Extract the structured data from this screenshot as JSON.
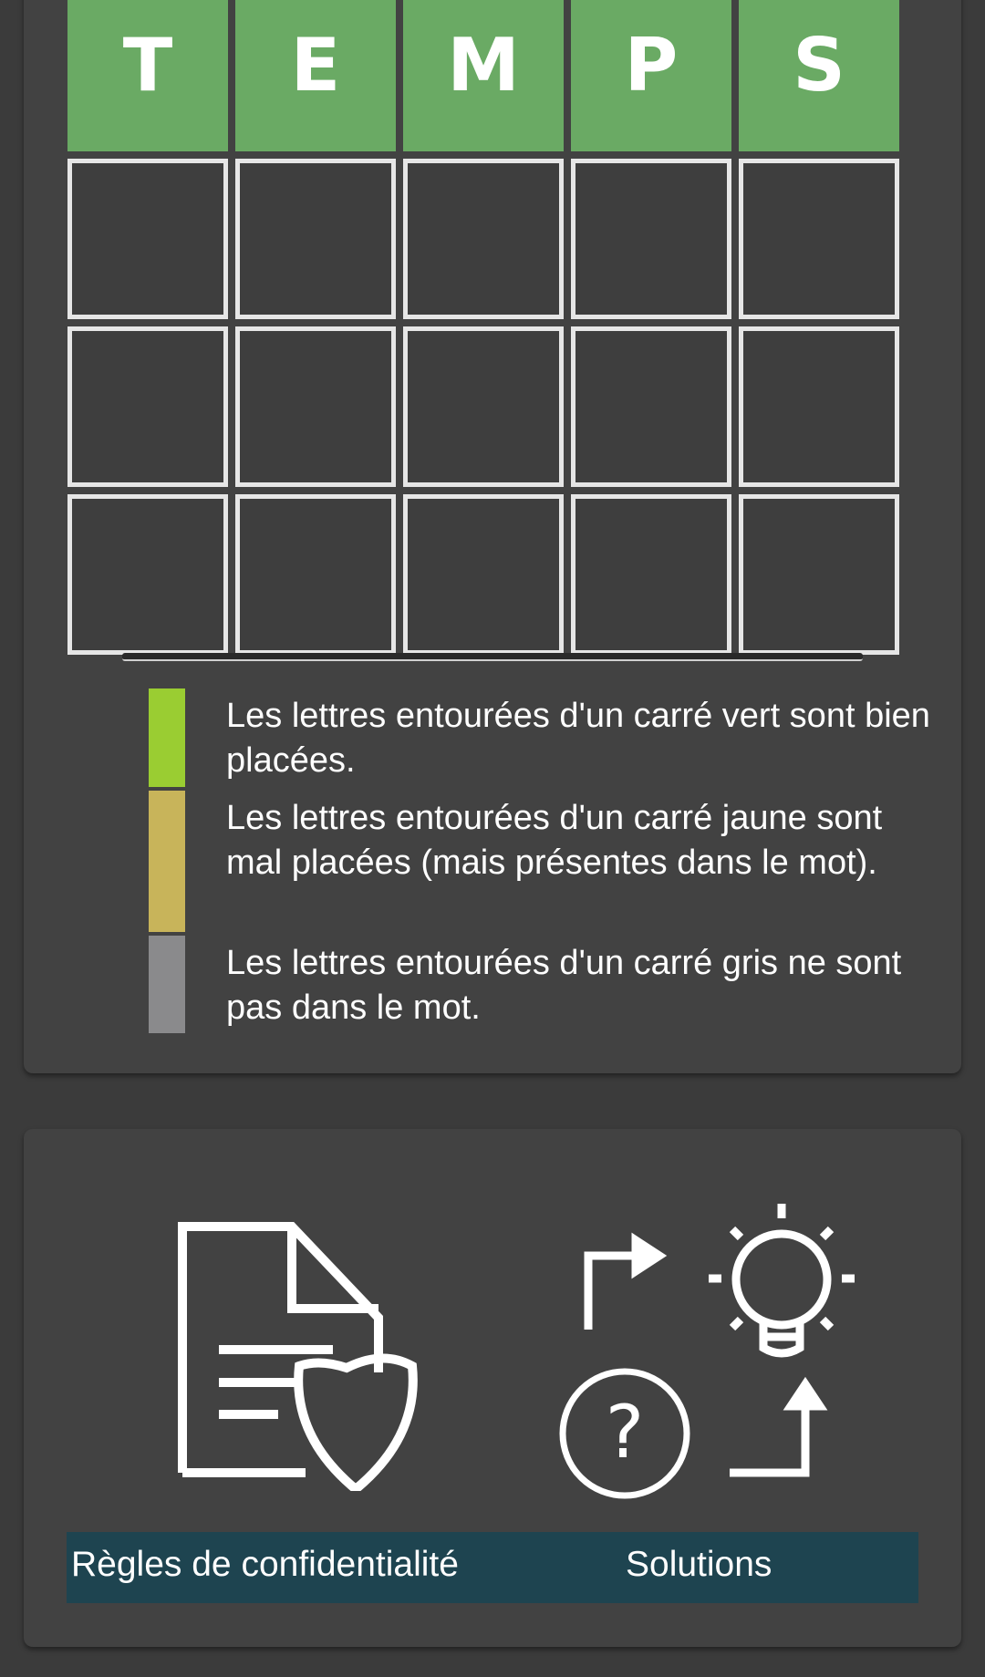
{
  "grid": {
    "rows": [
      [
        "T",
        "E",
        "M",
        "P",
        "S"
      ],
      [
        "",
        "",
        "",
        "",
        ""
      ],
      [
        "",
        "",
        "",
        "",
        ""
      ],
      [
        "",
        "",
        "",
        "",
        ""
      ]
    ]
  },
  "legend": {
    "items": [
      {
        "color": "#9acd32",
        "text": "Les lettres entourées d'un carré vert sont bien placées."
      },
      {
        "color": "#c8b45a",
        "text": "Les lettres entourées d'un carré jaune sont mal placées (mais présentes dans le mot)."
      },
      {
        "color": "#8a8a8c",
        "text": "Les lettres entourées d'un carré gris ne sont pas dans le mot."
      }
    ]
  },
  "footer": {
    "privacy_icon": "document-shield-icon",
    "solutions_icon": "solutions-lightbulb-question-icon",
    "privacy_label": "Règles de confidentialité",
    "solutions_label": "Solutions"
  },
  "colors": {
    "tile_correct": "#6aaa64",
    "links_bar": "#1e4450",
    "background": "#3b3b3b",
    "card": "#424242"
  }
}
